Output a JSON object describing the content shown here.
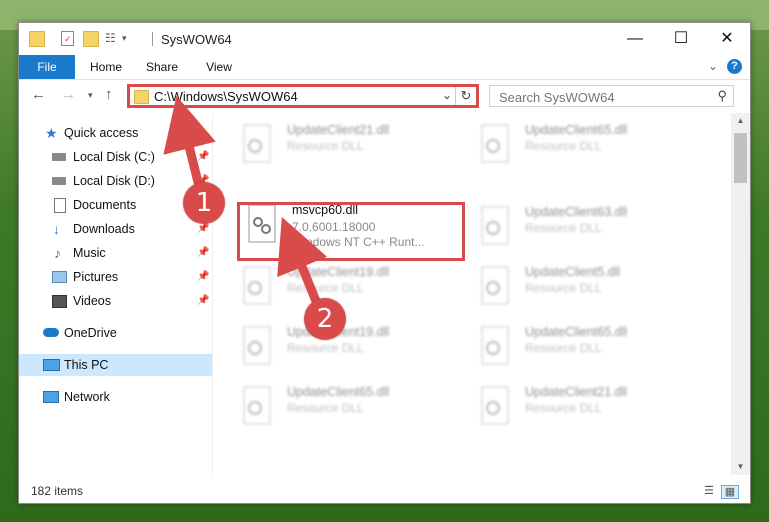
{
  "window": {
    "title": "SysWOW64",
    "minimize_icon": "minimize-icon",
    "maximize_icon": "maximize-icon",
    "close_icon": "close-icon"
  },
  "ribbon": {
    "tabs": [
      "File",
      "Home",
      "Share",
      "View"
    ],
    "accent": "#1979ca"
  },
  "address": {
    "path": "C:\\Windows\\SysWOW64",
    "search_placeholder": "Search SysWOW64"
  },
  "nav": {
    "items": [
      {
        "label": "Quick access",
        "icon": "star-icon",
        "pinned": false
      },
      {
        "label": "Local Disk (C:)",
        "icon": "drive-icon",
        "pinned": true
      },
      {
        "label": "Local Disk (D:)",
        "icon": "drive-icon",
        "pinned": true
      },
      {
        "label": "Documents",
        "icon": "documents-icon",
        "pinned": true
      },
      {
        "label": "Downloads",
        "icon": "download-icon",
        "pinned": true
      },
      {
        "label": "Music",
        "icon": "music-icon",
        "pinned": true
      },
      {
        "label": "Pictures",
        "icon": "pictures-icon",
        "pinned": true
      },
      {
        "label": "Videos",
        "icon": "videos-icon",
        "pinned": true
      },
      {
        "label": "OneDrive",
        "icon": "onedrive-icon",
        "pinned": false
      },
      {
        "label": "This PC",
        "icon": "computer-icon",
        "pinned": false,
        "selected": true
      },
      {
        "label": "Network",
        "icon": "network-icon",
        "pinned": false
      }
    ]
  },
  "files": {
    "selected": {
      "name": "msvcp60.dll",
      "version": "7.0.6001.18000",
      "description": "Windows NT C++ Runt..."
    },
    "blurred": [
      {
        "name": "UpdateClient21.dll",
        "type": "Resource DLL"
      },
      {
        "name": "UpdateClient65.dll",
        "type": "Resource DLL"
      },
      {
        "name": "UpdateClient63.dll",
        "type": "Resource DLL"
      },
      {
        "name": "UpdateClient19.dll",
        "type": "Resource DLL"
      },
      {
        "name": "UpdateClient5.dll",
        "type": "Resource DLL"
      },
      {
        "name": "UpdateClient19.dll",
        "type": "Resource DLL"
      },
      {
        "name": "UpdateClient65.dll",
        "type": "Resource DLL"
      },
      {
        "name": "UpdateClient65.dll",
        "type": "Resource DLL"
      },
      {
        "name": "UpdateClient21.dll",
        "type": "Resource DLL"
      }
    ]
  },
  "status": {
    "item_count": "182 items"
  },
  "annotations": {
    "step1": "1",
    "step2": "2",
    "color": "#d94b4b"
  }
}
